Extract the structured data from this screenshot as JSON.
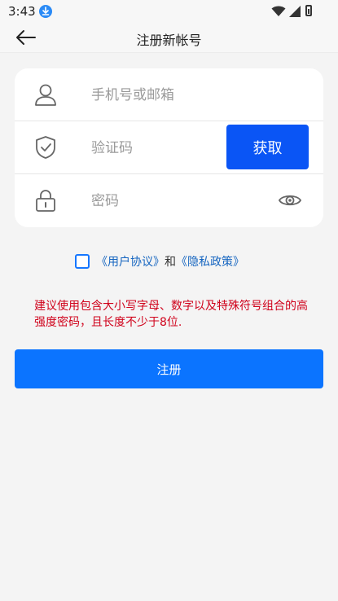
{
  "statusbar": {
    "time": "3:43"
  },
  "header": {
    "title": "注册新帐号"
  },
  "form": {
    "phone_placeholder": "手机号或邮箱",
    "code_placeholder": "验证码",
    "password_placeholder": "密码",
    "get_code_label": "获取"
  },
  "agreement": {
    "user_agreement": "《用户协议》",
    "and": "和",
    "privacy_policy": "《隐私政策》"
  },
  "hint": "建议使用包含大小写字母、数字以及特殊符号组合的高强度密码，且长度不少于8位.",
  "register_label": "注册",
  "colors": {
    "primary": "#0b74ff",
    "get_code": "#0a55f5",
    "hint": "#d0021b",
    "link": "#1565c0"
  },
  "icons": [
    "download-icon",
    "wifi-icon",
    "signal-icon",
    "battery-icon",
    "back-arrow-icon",
    "user-icon",
    "shield-check-icon",
    "lock-icon",
    "eye-icon"
  ]
}
